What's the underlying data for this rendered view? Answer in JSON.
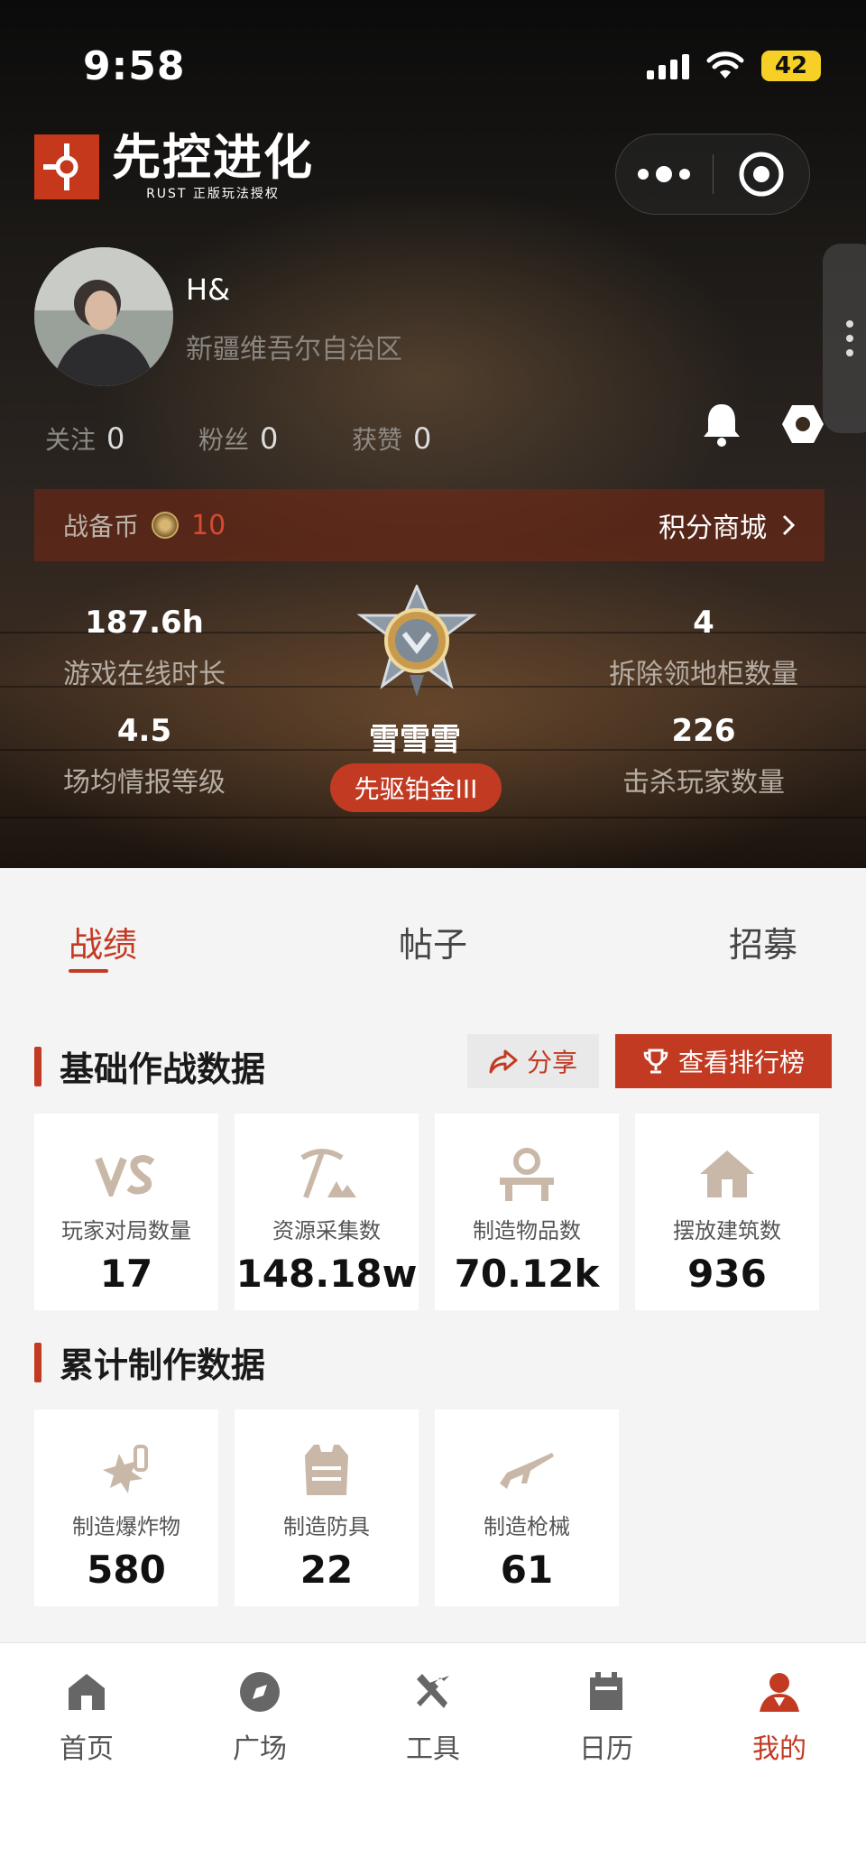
{
  "status": {
    "time": "9:58",
    "battery": "42"
  },
  "logo": {
    "title": "先控进化",
    "subtitle": "RUST 正版玩法授权"
  },
  "profile": {
    "username": "H&",
    "region": "新疆维吾尔自治区"
  },
  "social": [
    {
      "label": "关注",
      "value": "0"
    },
    {
      "label": "粉丝",
      "value": "0"
    },
    {
      "label": "获赞",
      "value": "0"
    }
  ],
  "coins": {
    "label": "战备币",
    "value": "10",
    "shop_label": "积分商城"
  },
  "hero_stats": {
    "online_hours": {
      "value": "187.6h",
      "label": "游戏在线时长"
    },
    "intel_level": {
      "value": "4.5",
      "label": "场均情报等级"
    },
    "cabinets": {
      "value": "4",
      "label": "拆除领地柜数量"
    },
    "kills": {
      "value": "226",
      "label": "击杀玩家数量"
    }
  },
  "rank": {
    "player_name": "雪雪雪",
    "tier": "先驱铂金III"
  },
  "tabs": [
    "战绩",
    "帖子",
    "招募"
  ],
  "section_basic": {
    "title": "基础作战数据",
    "share_label": "分享",
    "leaderboard_label": "查看排行榜",
    "cards": [
      {
        "icon": "vs-icon",
        "label": "玩家对局数量",
        "value": "17"
      },
      {
        "icon": "pickaxe-icon",
        "label": "资源采集数",
        "value": "148.18w"
      },
      {
        "icon": "workbench-icon",
        "label": "制造物品数",
        "value": "70.12k"
      },
      {
        "icon": "house-icon",
        "label": "摆放建筑数",
        "value": "936"
      }
    ]
  },
  "section_craft": {
    "title": "累计制作数据",
    "cards": [
      {
        "icon": "explosive-icon",
        "label": "制造爆炸物",
        "value": "580"
      },
      {
        "icon": "armor-icon",
        "label": "制造防具",
        "value": "22"
      },
      {
        "icon": "rifle-icon",
        "label": "制造枪械",
        "value": "61"
      }
    ]
  },
  "nav": [
    "首页",
    "广场",
    "工具",
    "日历",
    "我的"
  ],
  "colors": {
    "accent": "#c23a22",
    "icon_tan": "#c9b8a8"
  }
}
